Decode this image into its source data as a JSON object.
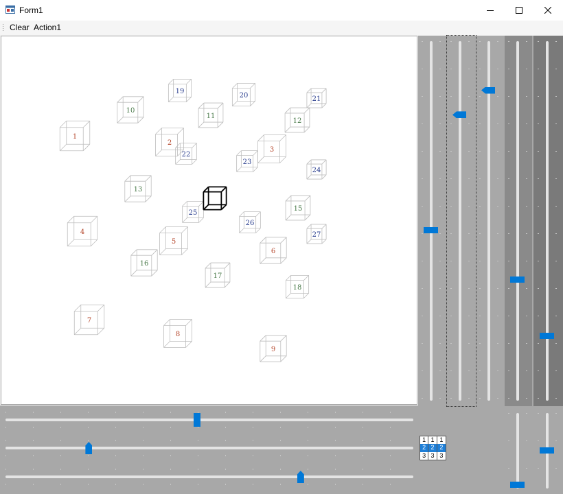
{
  "window": {
    "title": "Form1",
    "icon": "winforms-app-icon",
    "controls": [
      "minimize-icon",
      "maximize-icon",
      "close-icon"
    ]
  },
  "menu": {
    "items": [
      {
        "label": "Clear"
      },
      {
        "label": "Action1"
      }
    ]
  },
  "canvas": {
    "cubes": [
      {
        "label": "1"
      },
      {
        "label": "2"
      },
      {
        "label": "3"
      },
      {
        "label": "4"
      },
      {
        "label": "5"
      },
      {
        "label": "6"
      },
      {
        "label": "7"
      },
      {
        "label": "8"
      },
      {
        "label": "9"
      },
      {
        "label": "10"
      },
      {
        "label": "11"
      },
      {
        "label": "12"
      },
      {
        "label": "13"
      },
      {
        "label": "15"
      },
      {
        "label": "16"
      },
      {
        "label": "17"
      },
      {
        "label": "18"
      },
      {
        "label": "19"
      },
      {
        "label": "20"
      },
      {
        "label": "21"
      },
      {
        "label": "22"
      },
      {
        "label": "23"
      },
      {
        "label": "24"
      },
      {
        "label": "25"
      },
      {
        "label": "26"
      },
      {
        "label": "27"
      }
    ],
    "label_colors": {
      "red": "#b5472c",
      "green": "#4a7a4a",
      "blue": "#2b3f8f"
    },
    "selected_cube_color": "#000000"
  },
  "sliders": {
    "vertical": [
      {
        "name": "vslider-1",
        "level": 0.47
      },
      {
        "name": "vslider-2",
        "level": 0.8
      },
      {
        "name": "vslider-3",
        "level": 0.87
      },
      {
        "name": "vslider-4",
        "level": 0.33
      },
      {
        "name": "vslider-5",
        "level": 0.17
      }
    ],
    "horizontal": [
      {
        "name": "hslider-1",
        "level": 0.47
      },
      {
        "name": "hslider-2",
        "level": 0.2
      },
      {
        "name": "hslider-3",
        "level": 0.73
      }
    ],
    "small_vertical": [
      {
        "name": "small-vslider-1",
        "level": 0.0
      },
      {
        "name": "small-vslider-2",
        "level": 0.5
      }
    ]
  },
  "number_grid": {
    "rows": [
      [
        "1",
        "1",
        "1"
      ],
      [
        "2",
        "2",
        "2"
      ],
      [
        "3",
        "3",
        "3"
      ]
    ],
    "selected_row": 1
  },
  "colors": {
    "accent": "#0078d7",
    "panel": "#a8a8a8",
    "panel_dark": "#8a8a8a",
    "panel_darker": "#7a7a7a"
  }
}
